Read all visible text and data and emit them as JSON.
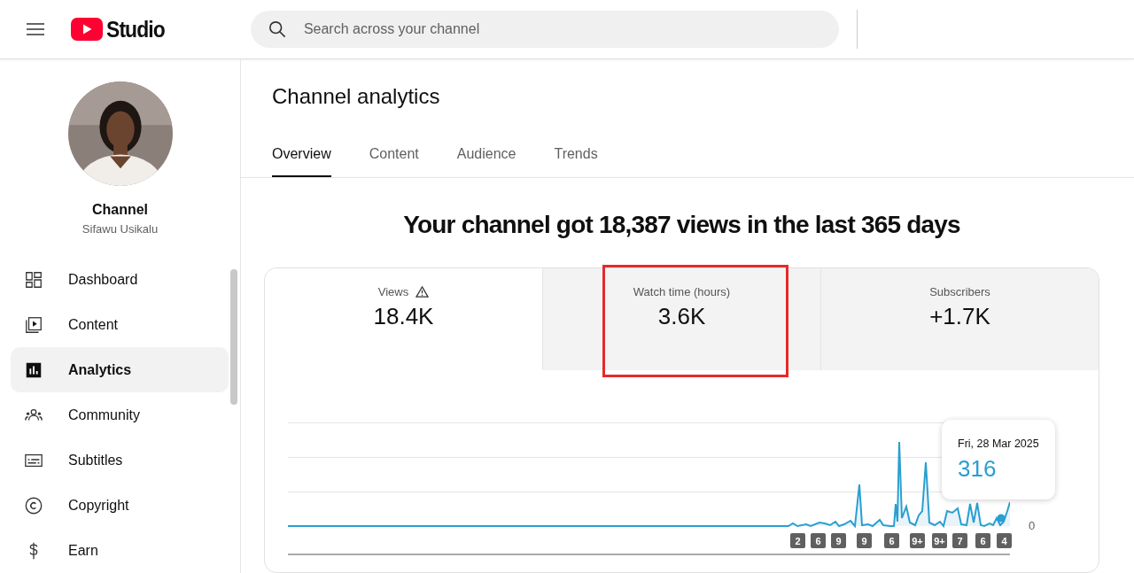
{
  "header": {
    "logo_text": "Studio",
    "search": {
      "placeholder": "Search across your channel"
    }
  },
  "sidebar": {
    "channel_label": "Channel",
    "channel_name": "Sifawu Usikalu",
    "items": [
      {
        "label": "Dashboard",
        "kind": "dashboard",
        "selected": false
      },
      {
        "label": "Content",
        "kind": "content",
        "selected": false
      },
      {
        "label": "Analytics",
        "kind": "analytics",
        "selected": true
      },
      {
        "label": "Community",
        "kind": "community",
        "selected": false
      },
      {
        "label": "Subtitles",
        "kind": "subtitles",
        "selected": false
      },
      {
        "label": "Copyright",
        "kind": "copyright",
        "selected": false
      },
      {
        "label": "Earn",
        "kind": "earn",
        "selected": false
      }
    ]
  },
  "page": {
    "title": "Channel analytics",
    "tabs": [
      {
        "label": "Overview",
        "selected": true
      },
      {
        "label": "Content",
        "selected": false
      },
      {
        "label": "Audience",
        "selected": false
      },
      {
        "label": "Trends",
        "selected": false
      }
    ],
    "headline": "Your channel got 18,387 views in the last 365 days",
    "metrics": [
      {
        "label": "Views",
        "value": "18.4K",
        "warning": true,
        "selected": true,
        "highlighted": false
      },
      {
        "label": "Watch time (hours)",
        "value": "3.6K",
        "warning": false,
        "selected": false,
        "highlighted": true
      },
      {
        "label": "Subscribers",
        "value": "+1.7K",
        "warning": false,
        "selected": false,
        "highlighted": false
      }
    ],
    "chart": {
      "y_axis_label": "0",
      "markers": [
        "2",
        "6",
        "9",
        "9",
        "6",
        "9+",
        "9+",
        "7",
        "6",
        "4"
      ],
      "tooltip": {
        "date": "Fri, 28 Mar 2025",
        "value": "316"
      }
    }
  }
}
